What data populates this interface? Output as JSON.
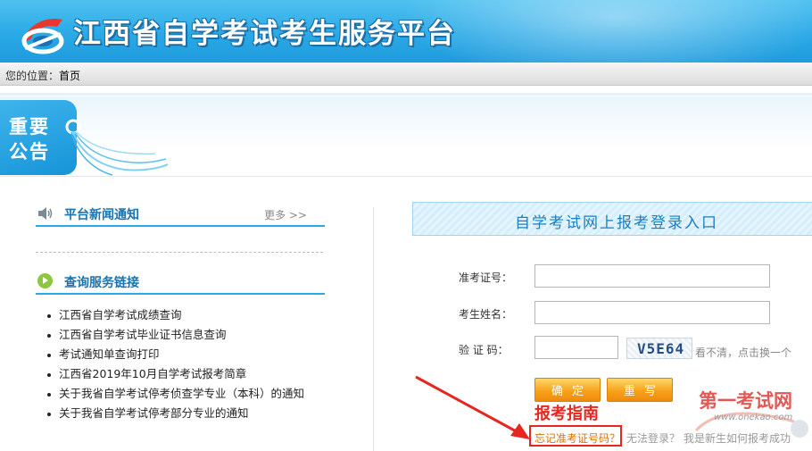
{
  "header": {
    "site_title": "江西省自学考试考生服务平台",
    "logo_icon": "exam-logo-icon",
    "colors": {
      "banner": "#2aa9e6",
      "title_outline": "#1a6ea8"
    }
  },
  "breadcrumb": {
    "label": "您的位置：",
    "home": "首页"
  },
  "notice": {
    "line1": "重要",
    "line2": "公告"
  },
  "news": {
    "title": "平台新闻通知",
    "more": "更多 >>",
    "icon": "speaker-icon"
  },
  "links": {
    "title": "查询服务链接",
    "icon": "play-circle-icon",
    "items": [
      "江西省自学考试成绩查询",
      "江西省自学考试毕业证书信息查询",
      "考试通知单查询打印",
      "江西省2019年10月自学考试报考简章",
      "关于我省自学考试停考侦查学专业（本科）的通知",
      "关于我省自学考试停考部分专业的通知"
    ]
  },
  "login": {
    "title": "自学考试网上报考登录入口",
    "fields": {
      "ticket_label": "准考证号：",
      "ticket_value": "",
      "name_label": "考生姓名：",
      "name_value": "",
      "captcha_label": "验 证 码：",
      "captcha_value": ""
    },
    "captcha_image_text": "V5E64",
    "captcha_hint": "看不清，点击换一个",
    "confirm_button": "确定",
    "reset_button": "重写",
    "forgot_link": "忘记准考证号码？",
    "cant_login_link": "无法登录？",
    "newbie_link": "我是新生如何报考成功",
    "accent_color": "#f7a21b"
  },
  "annotation": {
    "guide_text": "报考指南",
    "color": "#e6261f"
  },
  "watermark": {
    "text": "第一考试网",
    "url": "www.onekao.com"
  }
}
